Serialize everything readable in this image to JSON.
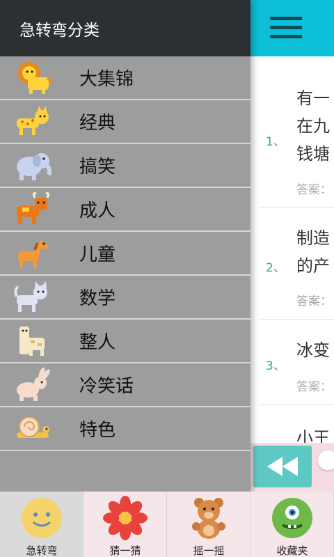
{
  "drawer": {
    "title": "急转弯分类",
    "categories": [
      {
        "label": "大集锦",
        "icon": "lion-icon"
      },
      {
        "label": "经典",
        "icon": "leopard-icon"
      },
      {
        "label": "搞笑",
        "icon": "elephant-icon"
      },
      {
        "label": "成人",
        "icon": "bull-icon"
      },
      {
        "label": "儿童",
        "icon": "horse-icon"
      },
      {
        "label": "数学",
        "icon": "cat-icon"
      },
      {
        "label": "整人",
        "icon": "giraffe-icon"
      },
      {
        "label": "冷笑话",
        "icon": "rabbit-icon"
      },
      {
        "label": "特色",
        "icon": "snail-icon"
      }
    ]
  },
  "content": {
    "menu_icon": "hamburger-menu-icon",
    "items": [
      {
        "num": "1、",
        "lines": [
          "有一",
          "在九",
          "钱塘"
        ],
        "answer": "答案："
      },
      {
        "num": "2、",
        "lines": [
          "制造",
          "的产"
        ],
        "answer": "答案："
      },
      {
        "num": "3、",
        "lines": [
          "冰变"
        ],
        "answer": "答案："
      },
      {
        "num": "",
        "lines": [
          "小王"
        ],
        "answer": ""
      }
    ]
  },
  "player": {
    "rewind_icon": "rewind-icon"
  },
  "tabs": [
    {
      "label": "急转弯",
      "icon": "smiley-icon",
      "active": true
    },
    {
      "label": "猜一猜",
      "icon": "flower-icon",
      "active": false
    },
    {
      "label": "摇一摇",
      "icon": "teddy-bear-icon",
      "active": false
    },
    {
      "label": "收藏夹",
      "icon": "monster-icon",
      "active": false
    }
  ],
  "colors": {
    "header_teal": "#0cbfd6",
    "drawer_header": "#2c3033",
    "drawer_bg": "#9d9d9d",
    "number_teal": "#35a6a6"
  }
}
